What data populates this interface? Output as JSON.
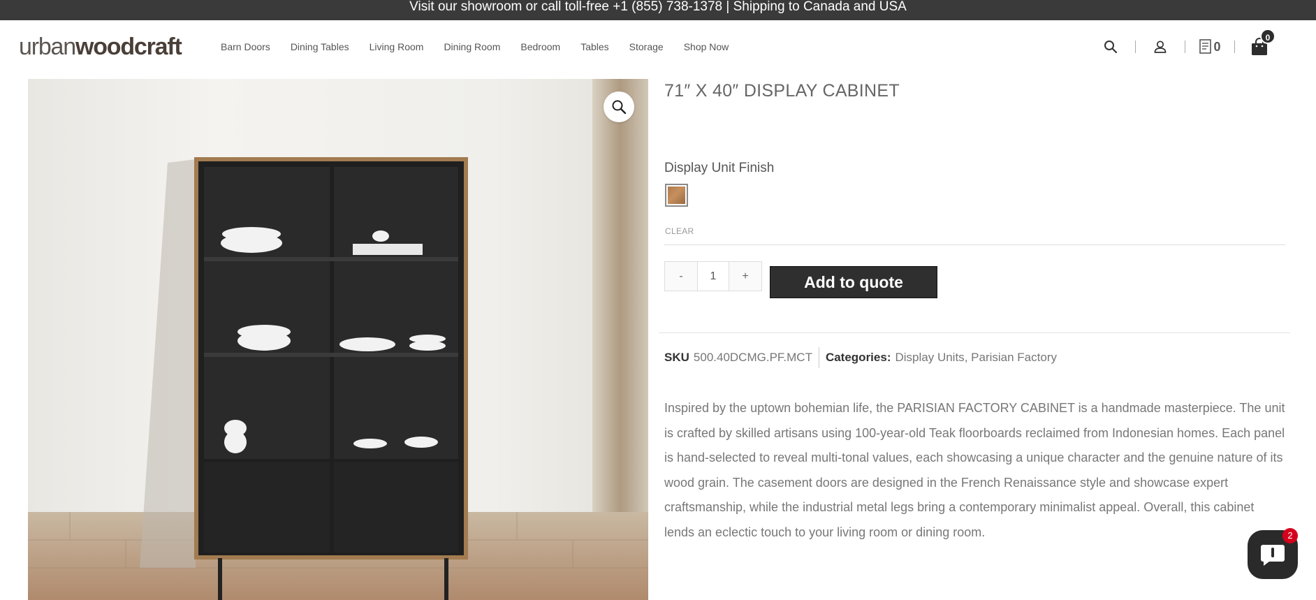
{
  "announcement": "Visit our showroom or call toll-free +1 (855) 738-1378 | Shipping to Canada and USA",
  "logo": {
    "light": "urban",
    "bold": "woodcraft"
  },
  "nav": [
    "Barn Doors",
    "Dining Tables",
    "Living Room",
    "Dining Room",
    "Bedroom",
    "Tables",
    "Storage",
    "Shop Now"
  ],
  "header_icons": {
    "search": "search-icon",
    "account": "user-icon",
    "quote": "quote-list-icon",
    "quote_count": "0",
    "cart": "shopping-bag-icon",
    "cart_count": "0"
  },
  "product": {
    "title": "71″ X 40″ DISPLAY CABINET",
    "finish_label": "Display Unit Finish",
    "clear_label": "CLEAR",
    "quantity": "1",
    "qty_minus": "-",
    "qty_plus": "+",
    "add_to_quote": "Add to quote",
    "sku_label": "SKU",
    "sku": "500.40DCMG.PF.MCT",
    "categories_label": "Categories:",
    "categories": [
      "Display Units",
      "Parisian Factory"
    ],
    "category_separator": ",",
    "description": "Inspired by the uptown bohemian life, the PARISIAN FACTORY CABINET is a handmade masterpiece. The unit is crafted by skilled artisans using 100-year-old Teak floorboards reclaimed from Indonesian homes. Each panel is hand-selected to reveal multi-tonal values, each showcasing a unique character and the genuine nature of its wood grain. The casement doors are designed in the French Renaissance style and showcase expert craftsmanship, while the industrial metal legs bring a contemporary minimalist appeal. Overall, this cabinet lends an eclectic touch to your living room or dining room."
  },
  "chat": {
    "badge": "2"
  },
  "colors": {
    "topbar": "#3a3a3a",
    "button": "#2f2f2f",
    "badge_red": "#d6001c",
    "wood": "#b07a4e"
  }
}
